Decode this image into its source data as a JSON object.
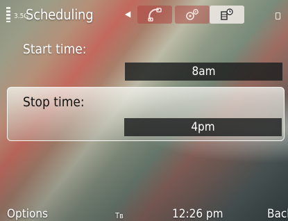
{
  "statusbar": {
    "network_indicator": "3.5G",
    "title": "Scheduling",
    "back_arrow": "◀",
    "tabs": [
      {
        "icon": "phone-icon",
        "active": false
      },
      {
        "icon": "connection-icon",
        "active": false
      },
      {
        "icon": "schedule-icon",
        "active": true
      }
    ]
  },
  "form": {
    "start_label": "Start time:",
    "start_value": "8am",
    "stop_label": "Stop time:",
    "stop_value": "4pm"
  },
  "softkeys": {
    "left": "Options",
    "input_mode": "Tв",
    "clock": "12:26 pm",
    "right": "Back"
  },
  "colors": {
    "value_box": "#1c1e1e",
    "active_tab": "#ebe6e1",
    "inactive_tab": "#af4641"
  }
}
